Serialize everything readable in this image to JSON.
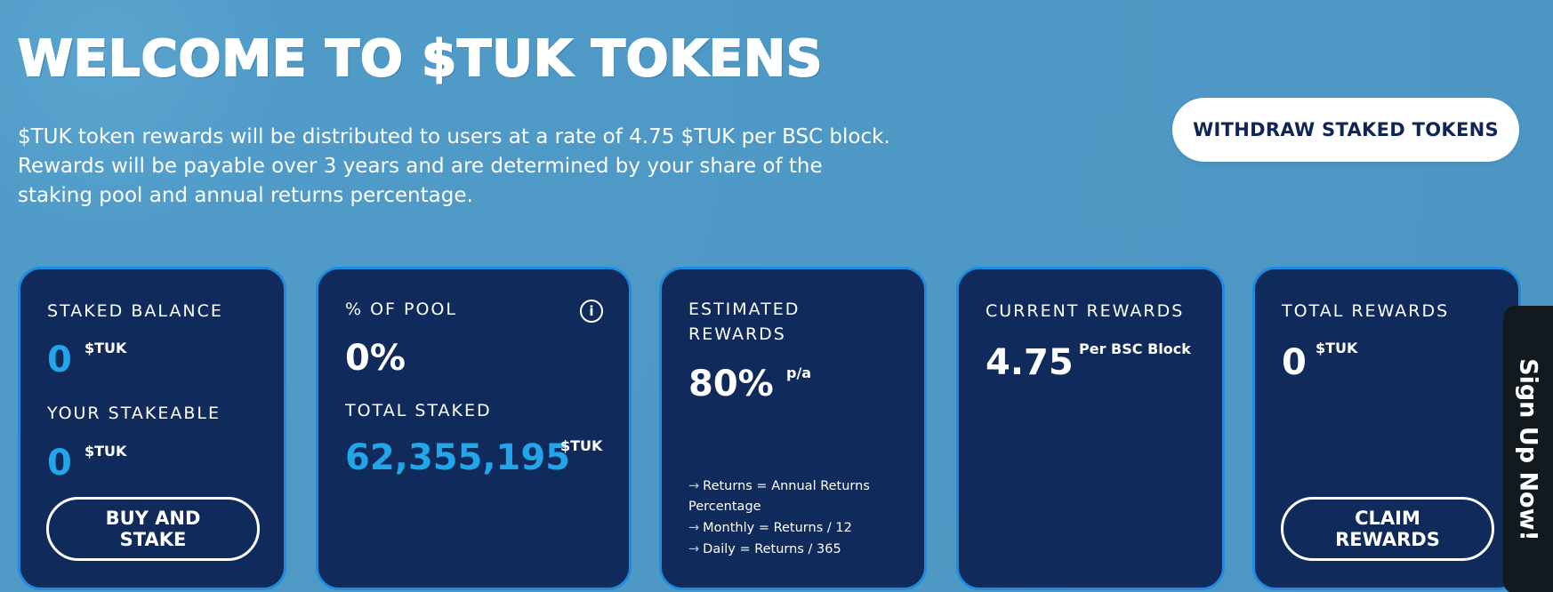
{
  "header": {
    "title": "WELCOME TO $TUK TOKENS",
    "description_line1": "$TUK token rewards will be distributed to users at a rate of 4.75 $TUK per BSC block.",
    "description_line2": "Rewards will be payable over 3 years and are determined by your share of the",
    "description_line3": "staking pool and annual returns percentage.",
    "withdraw_button_label": "WITHDRAW STAKED TOKENS"
  },
  "cards": {
    "staked": {
      "label": "STAKED BALANCE",
      "value": "0",
      "unit": "$TUK",
      "stakeable_label": "YOUR STAKEABLE",
      "stakeable_value": "0",
      "stakeable_unit": "$TUK",
      "button_line1": "BUY AND",
      "button_line2": "STAKE"
    },
    "pool": {
      "label": "% OF POOL",
      "info_icon": "i",
      "value": "0%",
      "total_label": "TOTAL STAKED",
      "total_value": "62,355,195",
      "total_unit": "$TUK"
    },
    "estimated": {
      "label_line1": "ESTIMATED",
      "label_line2": "REWARDS",
      "value": "80%",
      "unit": "p/a",
      "note1_line1": "Returns = Annual Returns",
      "note1_line2": "Percentage",
      "note2": "Monthly = Returns / 12",
      "note3": "Daily = Returns / 365"
    },
    "current": {
      "label": "CURRENT REWARDS",
      "value": "4.75",
      "unit": "Per BSC Block"
    },
    "total": {
      "label": "TOTAL REWARDS",
      "value": "0",
      "unit": "$TUK",
      "button_line1": "CLAIM",
      "button_line2": "REWARDS"
    }
  },
  "signup_tab": {
    "label": "Sign Up Now!"
  },
  "icons": {
    "info": "info-icon",
    "arrow": "arrow-right-icon"
  },
  "colors": {
    "background": "#4f9ac7",
    "card": "#112a5c",
    "card_border": "#1f8be0",
    "accent_cyan": "#22a6ea",
    "button_text": "#0e2556"
  }
}
